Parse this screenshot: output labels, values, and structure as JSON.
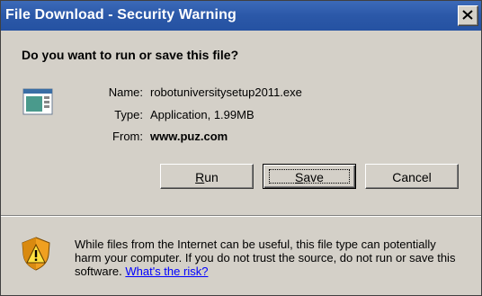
{
  "window": {
    "title": "File Download - Security Warning"
  },
  "dialog": {
    "question": "Do you want to run or save this file?",
    "name_label": "Name:",
    "name_value": "robotuniversitysetup2011.exe",
    "type_label": "Type:",
    "type_value": "Application, 1.99MB",
    "from_label": "From:",
    "from_value": "www.puz.com"
  },
  "buttons": {
    "run": {
      "label": "Run",
      "accel": "R",
      "rest": "un"
    },
    "save": {
      "label": "Save",
      "accel": "S",
      "rest": "ave"
    },
    "cancel": {
      "label": "Cancel"
    }
  },
  "warning": {
    "text": "While files from the Internet can be useful, this file type can potentially harm your computer. If you do not trust the source, do not run or save this software.",
    "link": "What's the risk?"
  },
  "colors": {
    "titlebar": "#2b58a8",
    "dialog_bg": "#d4d0c8",
    "link": "#0000ff"
  },
  "icons": {
    "close": "close-icon",
    "file": "application-file-icon",
    "warning": "shield-warning-icon"
  }
}
